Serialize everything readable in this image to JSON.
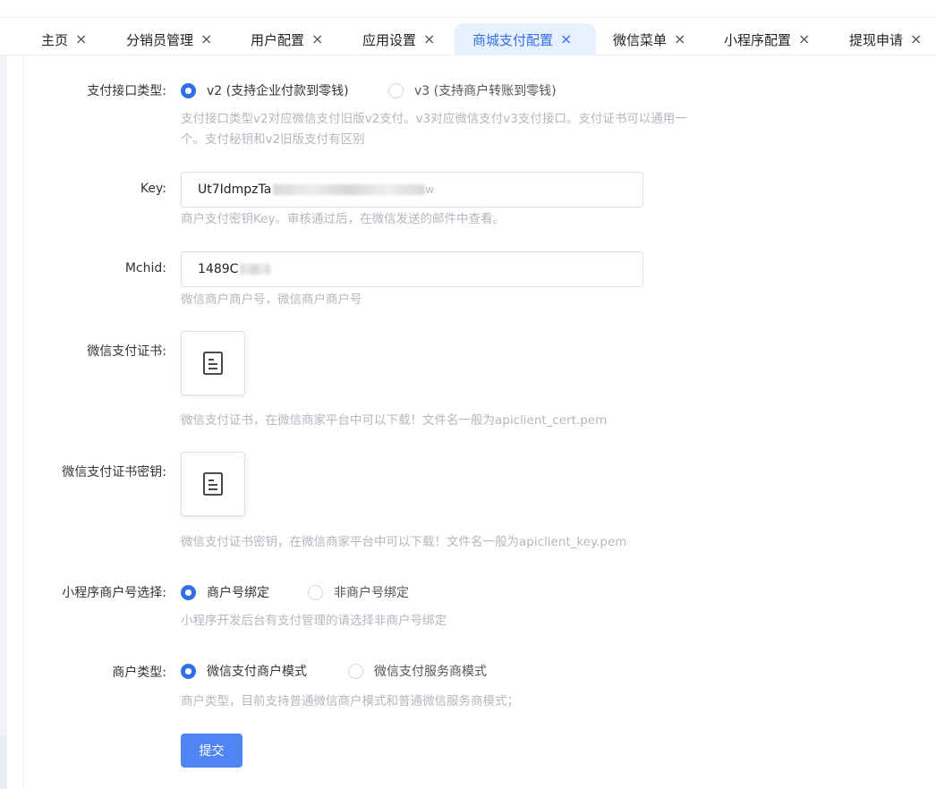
{
  "tabs": [
    {
      "label": "主页"
    },
    {
      "label": "分销员管理"
    },
    {
      "label": "用户配置"
    },
    {
      "label": "应用设置"
    },
    {
      "label": "商城支付配置"
    },
    {
      "label": "微信菜单"
    },
    {
      "label": "小程序配置"
    },
    {
      "label": "提现申请"
    }
  ],
  "tab_close_glyph": "×",
  "form": {
    "pay_type": {
      "label": "支付接口类型:",
      "options": [
        "v2 (支持企业付款到零钱)",
        "v3 (支持商户转账到零钱)"
      ],
      "selected": "v2 (支持企业付款到零钱)",
      "help_line1": "支付接口类型v2对应微信支付旧版v2支付。v3对应微信支付v3支付接口。支付证书可以通用一",
      "help_line2": "个。支付秘钥和v2旧版支付有区别"
    },
    "key": {
      "label": "Key:",
      "value_visible": "Ut7IdmpzTa",
      "value_tail": "w",
      "help": "商户支付密钥Key。审核通过后，在微信发送的邮件中查看。"
    },
    "mchid": {
      "label": "Mchid:",
      "value_visible": "1489C",
      "help": "微信商户商户号，微信商户商户号"
    },
    "cert": {
      "label": "微信支付证书:",
      "icon": "document-icon",
      "help": "微信支付证书，在微信商家平台中可以下载！文件名一般为apiclient_cert.pem"
    },
    "cert_key": {
      "label": "微信支付证书密钥:",
      "icon": "document-icon",
      "help": "微信支付证书密钥，在微信商家平台中可以下载！文件名一般为apiclient_key.pem"
    },
    "mini_merchant": {
      "label": "小程序商户号选择:",
      "options": [
        "商户号绑定",
        "非商户号绑定"
      ],
      "selected": "商户号绑定",
      "help": "小程序开发后台有支付管理的请选择非商户号绑定"
    },
    "merchant_type": {
      "label": "商户类型:",
      "options": [
        "微信支付商户模式",
        "微信支付服务商模式"
      ],
      "selected": "微信支付商户模式",
      "help": "商户类型，目前支持普通微信商户模式和普通微信服务商模式；"
    },
    "submit_label": "提交"
  },
  "colors": {
    "accent": "#2f6fe8",
    "active_tab_bg": "#e9f0fd",
    "button": "#4f86f3",
    "help_text": "#b3b7bd"
  }
}
